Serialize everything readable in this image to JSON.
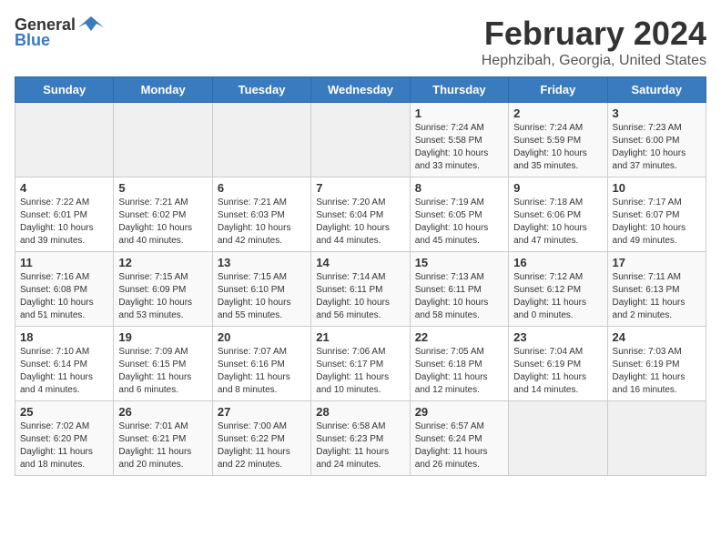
{
  "header": {
    "logo_general": "General",
    "logo_blue": "Blue",
    "title": "February 2024",
    "subtitle": "Hephzibah, Georgia, United States"
  },
  "weekdays": [
    "Sunday",
    "Monday",
    "Tuesday",
    "Wednesday",
    "Thursday",
    "Friday",
    "Saturday"
  ],
  "weeks": [
    [
      {
        "day": "",
        "info": ""
      },
      {
        "day": "",
        "info": ""
      },
      {
        "day": "",
        "info": ""
      },
      {
        "day": "",
        "info": ""
      },
      {
        "day": "1",
        "info": "Sunrise: 7:24 AM\nSunset: 5:58 PM\nDaylight: 10 hours\nand 33 minutes."
      },
      {
        "day": "2",
        "info": "Sunrise: 7:24 AM\nSunset: 5:59 PM\nDaylight: 10 hours\nand 35 minutes."
      },
      {
        "day": "3",
        "info": "Sunrise: 7:23 AM\nSunset: 6:00 PM\nDaylight: 10 hours\nand 37 minutes."
      }
    ],
    [
      {
        "day": "4",
        "info": "Sunrise: 7:22 AM\nSunset: 6:01 PM\nDaylight: 10 hours\nand 39 minutes."
      },
      {
        "day": "5",
        "info": "Sunrise: 7:21 AM\nSunset: 6:02 PM\nDaylight: 10 hours\nand 40 minutes."
      },
      {
        "day": "6",
        "info": "Sunrise: 7:21 AM\nSunset: 6:03 PM\nDaylight: 10 hours\nand 42 minutes."
      },
      {
        "day": "7",
        "info": "Sunrise: 7:20 AM\nSunset: 6:04 PM\nDaylight: 10 hours\nand 44 minutes."
      },
      {
        "day": "8",
        "info": "Sunrise: 7:19 AM\nSunset: 6:05 PM\nDaylight: 10 hours\nand 45 minutes."
      },
      {
        "day": "9",
        "info": "Sunrise: 7:18 AM\nSunset: 6:06 PM\nDaylight: 10 hours\nand 47 minutes."
      },
      {
        "day": "10",
        "info": "Sunrise: 7:17 AM\nSunset: 6:07 PM\nDaylight: 10 hours\nand 49 minutes."
      }
    ],
    [
      {
        "day": "11",
        "info": "Sunrise: 7:16 AM\nSunset: 6:08 PM\nDaylight: 10 hours\nand 51 minutes."
      },
      {
        "day": "12",
        "info": "Sunrise: 7:15 AM\nSunset: 6:09 PM\nDaylight: 10 hours\nand 53 minutes."
      },
      {
        "day": "13",
        "info": "Sunrise: 7:15 AM\nSunset: 6:10 PM\nDaylight: 10 hours\nand 55 minutes."
      },
      {
        "day": "14",
        "info": "Sunrise: 7:14 AM\nSunset: 6:11 PM\nDaylight: 10 hours\nand 56 minutes."
      },
      {
        "day": "15",
        "info": "Sunrise: 7:13 AM\nSunset: 6:11 PM\nDaylight: 10 hours\nand 58 minutes."
      },
      {
        "day": "16",
        "info": "Sunrise: 7:12 AM\nSunset: 6:12 PM\nDaylight: 11 hours\nand 0 minutes."
      },
      {
        "day": "17",
        "info": "Sunrise: 7:11 AM\nSunset: 6:13 PM\nDaylight: 11 hours\nand 2 minutes."
      }
    ],
    [
      {
        "day": "18",
        "info": "Sunrise: 7:10 AM\nSunset: 6:14 PM\nDaylight: 11 hours\nand 4 minutes."
      },
      {
        "day": "19",
        "info": "Sunrise: 7:09 AM\nSunset: 6:15 PM\nDaylight: 11 hours\nand 6 minutes."
      },
      {
        "day": "20",
        "info": "Sunrise: 7:07 AM\nSunset: 6:16 PM\nDaylight: 11 hours\nand 8 minutes."
      },
      {
        "day": "21",
        "info": "Sunrise: 7:06 AM\nSunset: 6:17 PM\nDaylight: 11 hours\nand 10 minutes."
      },
      {
        "day": "22",
        "info": "Sunrise: 7:05 AM\nSunset: 6:18 PM\nDaylight: 11 hours\nand 12 minutes."
      },
      {
        "day": "23",
        "info": "Sunrise: 7:04 AM\nSunset: 6:19 PM\nDaylight: 11 hours\nand 14 minutes."
      },
      {
        "day": "24",
        "info": "Sunrise: 7:03 AM\nSunset: 6:19 PM\nDaylight: 11 hours\nand 16 minutes."
      }
    ],
    [
      {
        "day": "25",
        "info": "Sunrise: 7:02 AM\nSunset: 6:20 PM\nDaylight: 11 hours\nand 18 minutes."
      },
      {
        "day": "26",
        "info": "Sunrise: 7:01 AM\nSunset: 6:21 PM\nDaylight: 11 hours\nand 20 minutes."
      },
      {
        "day": "27",
        "info": "Sunrise: 7:00 AM\nSunset: 6:22 PM\nDaylight: 11 hours\nand 22 minutes."
      },
      {
        "day": "28",
        "info": "Sunrise: 6:58 AM\nSunset: 6:23 PM\nDaylight: 11 hours\nand 24 minutes."
      },
      {
        "day": "29",
        "info": "Sunrise: 6:57 AM\nSunset: 6:24 PM\nDaylight: 11 hours\nand 26 minutes."
      },
      {
        "day": "",
        "info": ""
      },
      {
        "day": "",
        "info": ""
      }
    ]
  ]
}
